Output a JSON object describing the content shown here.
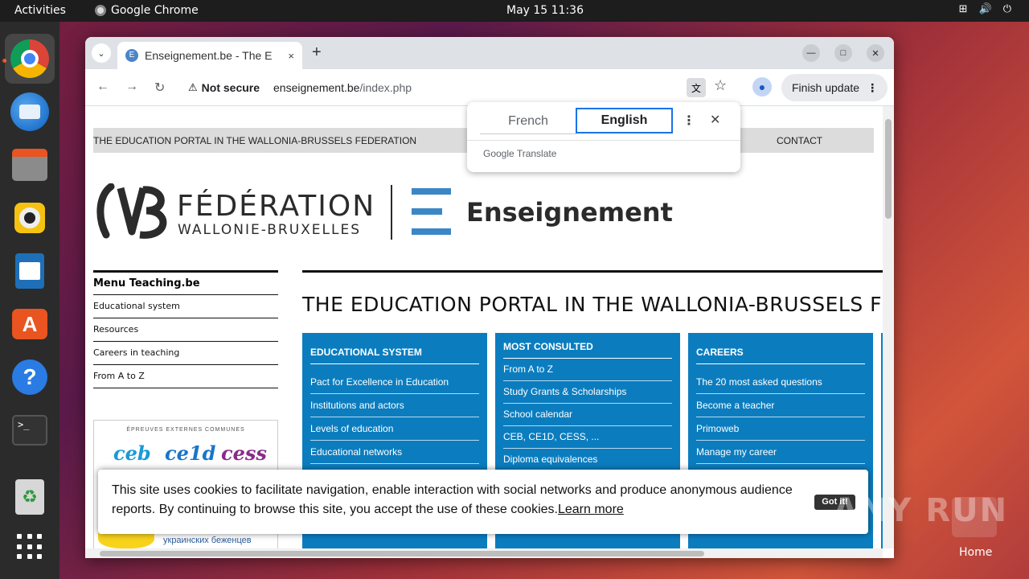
{
  "topbar": {
    "activities": "Activities",
    "app_name": "Google Chrome",
    "clock": "May 15  11:36"
  },
  "browser": {
    "tab_title": "Enseignement.be - The E",
    "tab_close": "×",
    "new_tab": "+",
    "url_security": "Not secure",
    "url_domain": "enseignement.be",
    "url_path": "/index.php",
    "finish_update": "Finish update"
  },
  "translate_popup": {
    "source_lang": "French",
    "target_lang": "English",
    "brand": "Google Translate"
  },
  "page": {
    "banner_left": "THE EDUCATION PORTAL IN THE WALLONIA-BRUSSELS FEDERATION",
    "banner_right": "CONTACT",
    "logo_fed": "FÉDÉRATION",
    "logo_wb": "WALLONIE-BRUXELLES",
    "logo_ens": "Enseignement",
    "menu_title": "Menu Teaching.be",
    "menu_items": [
      "Educational system",
      "Resources",
      "Careers in teaching",
      "From A to Z"
    ],
    "exams_header": "ÉPREUVES EXTERNES COMMUNES",
    "exams_words": [
      "ceb",
      "ce1d",
      "cess"
    ],
    "ukr_text": "украинских беженцев",
    "main_title": "THE EDUCATION PORTAL IN THE WALLONIA-BRUSSELS F",
    "col1": {
      "title": "EDUCATIONAL SYSTEM",
      "items": [
        "Pact for Excellence in Education",
        "Institutions and actors",
        "Levels of education",
        "Educational networks"
      ]
    },
    "col2": {
      "title": "MOST CONSULTED",
      "items": [
        "From A to Z",
        "Study Grants & Scholarships",
        "School calendar",
        "CEB, CE1D, CESS, ...",
        "Diploma equivalences"
      ]
    },
    "col3": {
      "title": "CAREERS",
      "items": [
        "The 20 most asked questions",
        "Become a teacher",
        "Primoweb",
        "Manage my career"
      ]
    }
  },
  "cookie": {
    "text": "This site uses cookies to facilitate navigation, enable interaction with social networks and produce anonymous audience reports. By continuing to browse this site, you accept the use of these cookies.",
    "learn_more": "Learn more",
    "button": "Got it!"
  },
  "desktop": {
    "home_label": "Home",
    "watermark": "ANY RUN"
  },
  "colors": {
    "portal_blue": "#0b7dbf",
    "ubuntu_orange": "#e95420",
    "chrome_focus": "#1a73e8"
  }
}
